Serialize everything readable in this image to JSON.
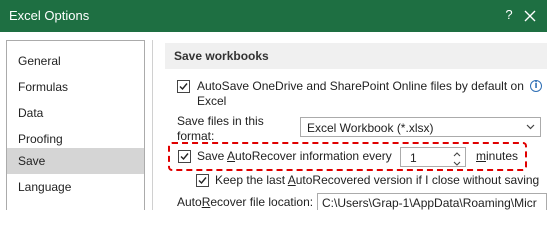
{
  "window": {
    "title": "Excel Options",
    "help_label": "?"
  },
  "colors": {
    "titlebar": "#1e6f42",
    "highlight_border": "#e00000",
    "nav_selected": "#d5d5d5"
  },
  "nav": {
    "items": [
      {
        "label": "General"
      },
      {
        "label": "Formulas"
      },
      {
        "label": "Data"
      },
      {
        "label": "Proofing"
      },
      {
        "label": "Save",
        "selected": true
      },
      {
        "label": "Language"
      }
    ]
  },
  "section": {
    "header": "Save workbooks"
  },
  "options": {
    "autosave": {
      "line1": "AutoSave OneDrive and SharePoint Online files by default on",
      "line2": "Excel",
      "checked": true,
      "info_icon": "i"
    },
    "format": {
      "label_line1": "Save files in this",
      "label_line2": "format:",
      "value": "Excel Workbook (*.xlsx)"
    },
    "autorecover": {
      "pre": "Save ",
      "accel": "A",
      "post": "utoRecover information every",
      "checked": true,
      "minutes_value": "1",
      "unit_accel": "m",
      "unit_rest": "inutes"
    },
    "keep_last": {
      "pre": "Keep the last ",
      "accel": "A",
      "post": "utoRecovered version if I close without saving",
      "checked": true
    },
    "file_location": {
      "pre": "Auto",
      "accel": "R",
      "post": "ecover file location:",
      "value": "C:\\Users\\Grap-1\\AppData\\Roaming\\Micr"
    }
  }
}
